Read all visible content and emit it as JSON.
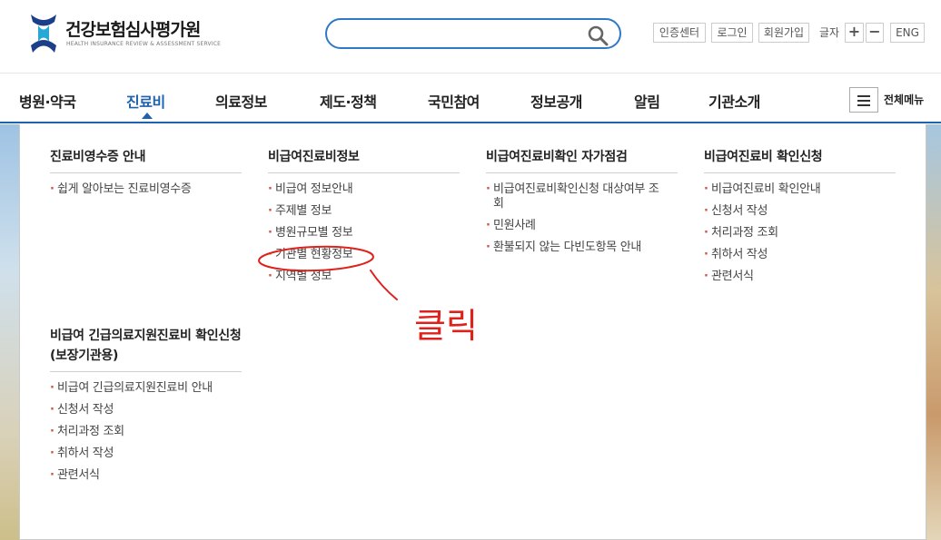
{
  "header": {
    "logo_text": "건강보험심사평가원",
    "logo_sub": "HEALTH INSURANCE REVIEW & ASSESSMENT SERVICE",
    "search_placeholder": "",
    "util": {
      "cert": "인증센터",
      "login": "로그인",
      "join": "회원가입",
      "font_label": "글자",
      "font_plus": "+",
      "font_minus": "−",
      "eng": "ENG"
    }
  },
  "gnb": {
    "items": [
      {
        "label": "병원·약국"
      },
      {
        "label": "진료비"
      },
      {
        "label": "의료정보"
      },
      {
        "label": "제도·정책"
      },
      {
        "label": "국민참여"
      },
      {
        "label": "정보공개"
      },
      {
        "label": "알림"
      },
      {
        "label": "기관소개"
      }
    ],
    "active_index": 1,
    "all_menu_label": "전체메뉴"
  },
  "submenu": {
    "columns": [
      {
        "title": "진료비영수증 안내",
        "items": [
          "쉽게 알아보는 진료비영수증"
        ]
      },
      {
        "title": "비급여진료비정보",
        "items": [
          "비급여 정보안내",
          "주제별 정보",
          "병원규모별 정보",
          "기관별 현황정보",
          "지역별 정보"
        ]
      },
      {
        "title": "비급여진료비확인 자가점검",
        "items": [
          "비급여진료비확인신청 대상여부 조회",
          "민원사례",
          "환불되지 않는 다빈도항목 안내"
        ]
      },
      {
        "title": "비급여진료비 확인신청",
        "items": [
          "비급여진료비 확인안내",
          "신청서 작성",
          "처리과정 조회",
          "취하서 작성",
          "관련서식"
        ]
      },
      {
        "title": "비급여 긴급의료지원진료비 확인신청(보장기관용)",
        "items": [
          "비급여 긴급의료지원진료비 안내",
          "신청서 작성",
          "처리과정 조회",
          "취하서 작성",
          "관련서식"
        ]
      }
    ]
  },
  "annotation": {
    "text": "클릭",
    "color": "#e0201a"
  },
  "colors": {
    "accent": "#1e62b0",
    "search_border": "#2f78c6",
    "bullet": "#d2533a"
  }
}
